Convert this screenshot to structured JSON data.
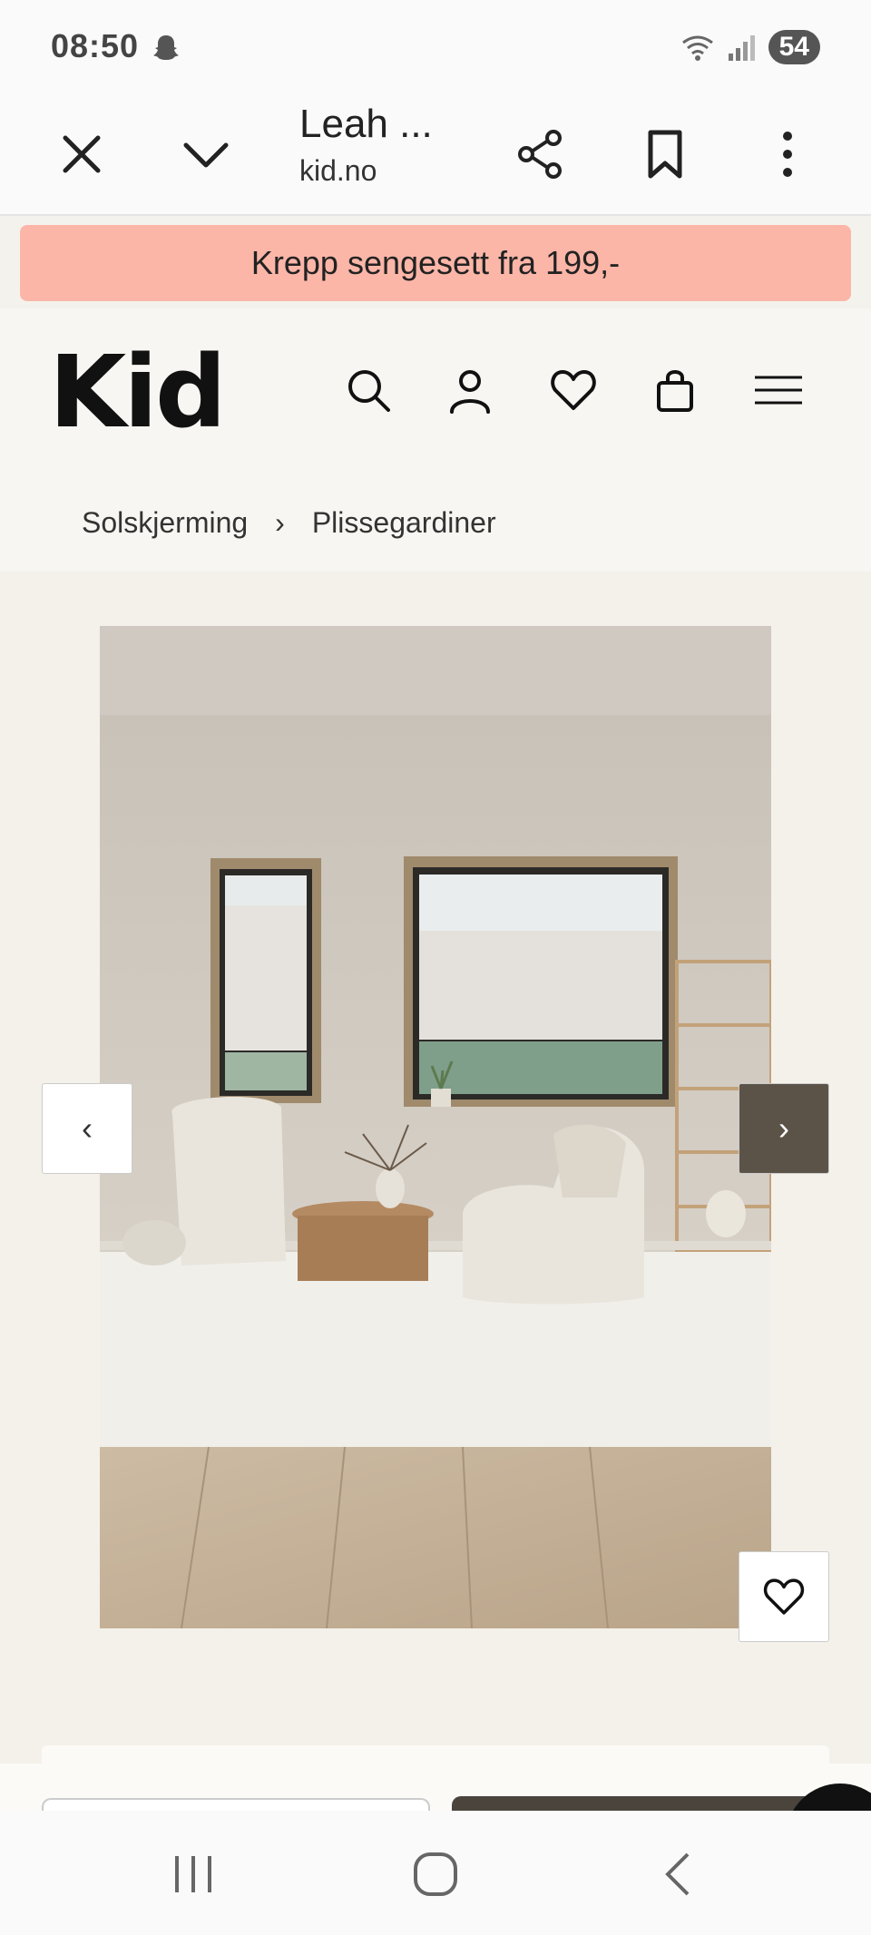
{
  "status_bar": {
    "time": "08:50",
    "battery": "54"
  },
  "browser": {
    "tab_title": "Leah ...",
    "tab_url": "kid.no",
    "icons": [
      "close-icon",
      "chevron-down-icon",
      "share-icon",
      "bookmark-icon",
      "more-vert-icon"
    ]
  },
  "promo": {
    "text": "Krepp sengesett fra 199,-"
  },
  "site": {
    "logo": "Kid",
    "header_icons": [
      "search-icon",
      "user-icon",
      "heart-icon",
      "bag-icon",
      "menu-icon"
    ],
    "breadcrumb": [
      "Solskjerming",
      "Plissegardiner"
    ]
  },
  "gallery": {
    "prev_label": "‹",
    "next_label": "›"
  },
  "colors": {
    "promo_bg": "#fbb6a8",
    "next_btn_bg": "#5c5348",
    "page_bg": "#f4f1ea"
  }
}
